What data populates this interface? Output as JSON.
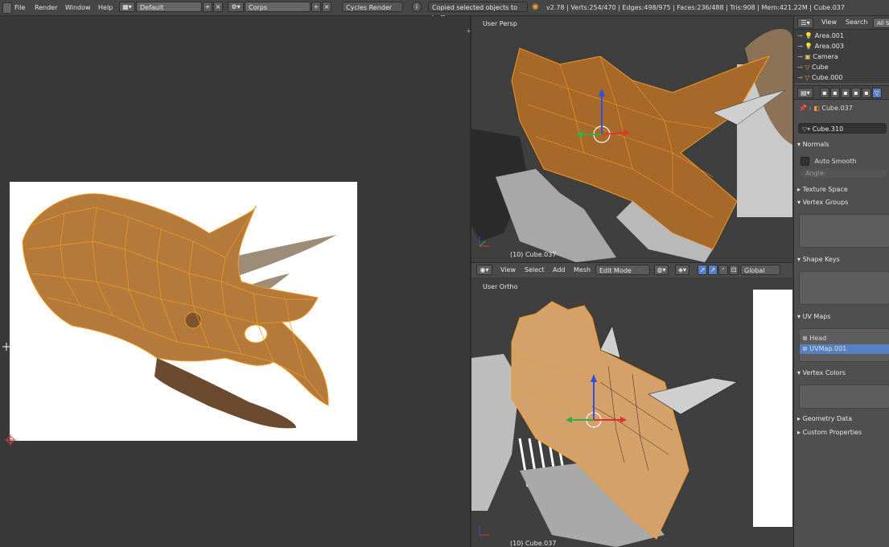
{
  "menubar": {
    "items": [
      "File",
      "Render",
      "Window",
      "Help"
    ],
    "screen_layout": "Default",
    "scene": "Corps",
    "render_engine": "Cycles Render",
    "status_message": "Copied selected objects to buffer",
    "stats": "v2.78 | Verts:254/470 | Edges:498/975 | Faces:236/488 | Tris:908 | Mem:421.22M | Cube.037"
  },
  "viewport_top": {
    "label": "User Persp",
    "object_label": "(10) Cube.037"
  },
  "viewport_header": {
    "view": "View",
    "select": "Select",
    "add": "Add",
    "mesh": "Mesh",
    "mode": "Edit Mode",
    "orientation": "Global"
  },
  "viewport_bottom": {
    "label": "User Ortho",
    "object_label": "(10) Cube.037"
  },
  "outliner": {
    "view": "View",
    "search": "Search",
    "all_scenes": "All S",
    "items": [
      "Area.001",
      "Area.003",
      "Camera",
      "Cube",
      "Cube.000"
    ]
  },
  "properties": {
    "breadcrumb_object": "Cube.037",
    "mesh_datablock": "Cube.310",
    "normals_header": "Normals",
    "auto_smooth": "Auto Smooth",
    "angle": "Angle:",
    "texture_space": "Texture Space",
    "vertex_groups": "Vertex Groups",
    "shape_keys": "Shape Keys",
    "uv_maps": "UV Maps",
    "uv_items": [
      "Head",
      "UVMap.001"
    ],
    "vertex_colors": "Vertex Colors",
    "geometry_data": "Geometry Data",
    "custom_properties": "Custom Properties"
  }
}
